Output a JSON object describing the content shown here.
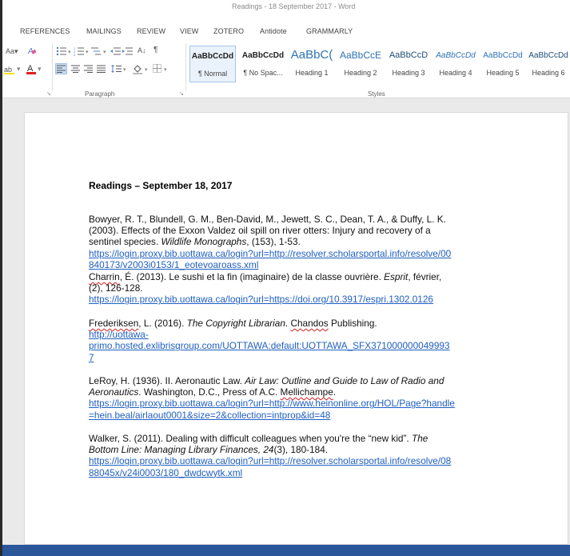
{
  "window": {
    "title": "Readings - 18 September 2017 - Word"
  },
  "tabs": [
    "REFERENCES",
    "MAILINGS",
    "REVIEW",
    "VIEW",
    "ZOTERO",
    "Antidote",
    "GRAMMARLY"
  ],
  "ribbon": {
    "font_group": {
      "change_case": "Aa",
      "dropdown": "▾"
    },
    "paragraph_group": {
      "label": "Paragraph",
      "sort": "A↓",
      "pilcrow": "¶"
    },
    "styles_group": {
      "label": "Styles",
      "items": [
        {
          "preview": "AaBbCcDd",
          "name": "¶ Normal"
        },
        {
          "preview": "AaBbCcDd",
          "name": "¶ No Spac..."
        },
        {
          "preview": "AaBbC(",
          "name": "Heading 1"
        },
        {
          "preview": "AaBbCcE",
          "name": "Heading 2"
        },
        {
          "preview": "AaBbCcD",
          "name": "Heading 3"
        },
        {
          "preview": "AaBbCcDd",
          "name": "Heading 4"
        },
        {
          "preview": "AaBbCcDd",
          "name": "Heading 5"
        },
        {
          "preview": "AaBbCcDd",
          "name": "Heading 6"
        }
      ]
    }
  },
  "document": {
    "title": "Readings – September 18, 2017",
    "entries": [
      {
        "lines": [
          "Bowyer, R. T., Blundell, G. M., Ben-David, M., Jewett, S. C., Dean, T. A., & Duffy, L. K.",
          "(2003). Effects of the Exxon Valdez oil spill on river otters: Injury and recovery of a",
          "sentinel species. ",
          "Wildlife Monographs",
          ", (153), 1-53."
        ],
        "links": [
          "https://login.proxy.bib.uottawa.ca/login?url=http://resolver.scholarsportal.info/resolve/00",
          "840173/v2003i0153/1_eotevoaroass.xml"
        ]
      },
      {
        "lines": [
          "Charrin",
          ", É. (2013). Le sushi et la fin (imaginaire) de la classe ouvrière. ",
          "Esprit",
          ", février,",
          "(2), 126-128."
        ],
        "links": [
          "https://login.proxy.bib.uottawa.ca/login?url=https://doi.org/10.3917/espri.1302.0126"
        ]
      },
      {
        "lines": [
          "Frederiksen",
          ", L. (2016). ",
          "The Copyright Librarian",
          ". ",
          "Chandos",
          " Publishing."
        ],
        "links": [
          "http://uottawa-",
          "primo.hosted.exlibrisgroup.com/UOTTAWA:default:UOTTAWA_SFX371000000049993",
          "7"
        ]
      },
      {
        "lines": [
          "LeRoy, H. (1936). II. Aeronautic Law. ",
          "Air Law: Outline and Guide to Law of Radio and",
          "Aeronautics",
          ". Washington, D.C., Press of A.C. ",
          "Mellichampe",
          "."
        ],
        "links": [
          "https://login.proxy.bib.uottawa.ca/login?url=http://www.heinonline.org/HOL/Page?handle",
          "=hein.beal/airlaout0001&size=2&collection=intprop&id=48"
        ]
      },
      {
        "lines": [
          "Walker, S. (2011). Dealing with difficult colleagues when you're the “new kid”. ",
          "The",
          "Bottom Line: Managing Library Finances, 24",
          "(3), 180-184."
        ],
        "links": [
          "https://login.proxy.bib.uottawa.ca/login?url=http://resolver.scholarsportal.info/resolve/08",
          "88045x/v24i0003/180_dwdcwytk.xml"
        ]
      }
    ]
  },
  "colors": {
    "accent": "#2b579a",
    "link": "#1f5fc1",
    "spelling": "#d02020",
    "selected_style": "#eaf2fb"
  }
}
